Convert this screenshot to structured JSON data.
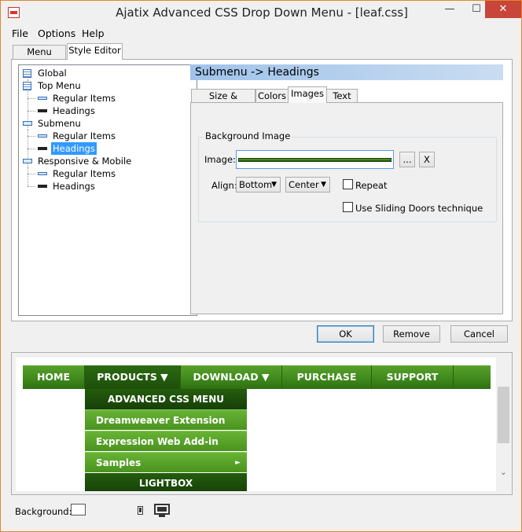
{
  "window": {
    "title": "Ajatix Advanced CSS Drop Down Menu - [leaf.css]",
    "controls": {
      "minimize": "—",
      "maximize": "☐",
      "close": "✕"
    }
  },
  "menubar": [
    "File",
    "Options",
    "Help"
  ],
  "tabs": {
    "menu_editor": "Menu Editor",
    "style_editor": "Style Editor"
  },
  "tree": {
    "global": "Global",
    "top_menu": "Top Menu",
    "top_regular": "Regular Items",
    "top_headings": "Headings",
    "submenu": "Submenu",
    "sub_regular": "Regular Items",
    "sub_headings": "Headings",
    "responsive": "Responsive & Mobile",
    "resp_regular": "Regular Items",
    "resp_headings": "Headings"
  },
  "section_header": "Submenu -> Headings",
  "subtabs": {
    "size_position": "Size & Position",
    "colors": "Colors",
    "images": "Images",
    "text": "Text"
  },
  "images_panel": {
    "group_title": "Background Image",
    "image_label": "Image:",
    "browse_label": "...",
    "clear_label": "X",
    "align_label": "Align:",
    "align_vertical": "Bottom",
    "align_horizontal": "Center",
    "repeat_label": "Repeat",
    "sliding_doors_label": "Use Sliding Doors technique"
  },
  "dialog_buttons": {
    "ok": "OK",
    "remove": "Remove",
    "cancel": "Cancel"
  },
  "preview": {
    "nav": [
      "HOME",
      "PRODUCTS ▼",
      "DOWNLOAD ▼",
      "PURCHASE",
      "SUPPORT"
    ],
    "submenu": {
      "heading": "ADVANCED CSS MENU",
      "items": [
        "Dreamweaver Extension",
        "Expression Web Add-in",
        "Samples"
      ],
      "samples_arrow": "►",
      "heading2": "LIGHTBOX"
    },
    "scroll_up": "⌃",
    "scroll_down": "⌄"
  },
  "footer": {
    "background_label": "Background:"
  },
  "colors": {
    "nav_green": "#4a931f",
    "nav_dark": "#1d4f0a",
    "selection": "#3399ff"
  }
}
